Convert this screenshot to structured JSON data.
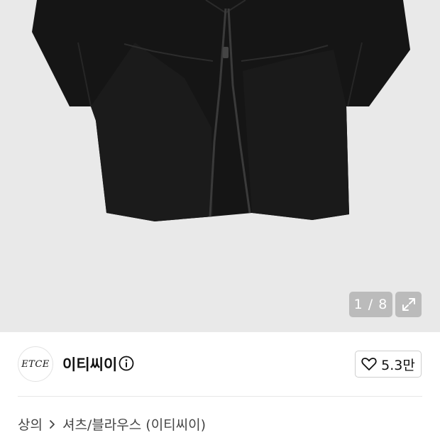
{
  "gallery": {
    "counter": "1 / 8",
    "background": "#e9e9e9"
  },
  "brand": {
    "logo_text": "ETCE",
    "name": "이티씨이"
  },
  "like": {
    "count": "5.3만"
  },
  "breadcrumb": {
    "category": "상의",
    "subcategory": "셔츠/블라우스 (이티씨이)"
  }
}
